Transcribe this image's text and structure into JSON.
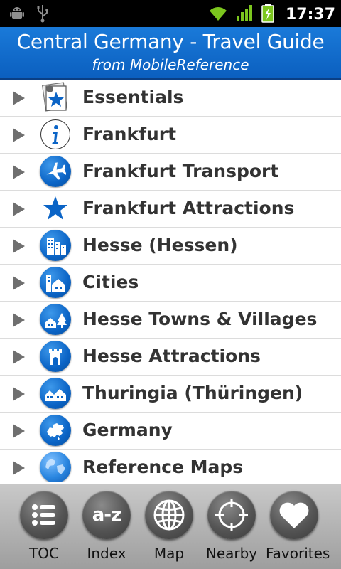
{
  "status_bar": {
    "time": "17:37"
  },
  "header": {
    "title": "Central Germany - Travel Guide",
    "subtitle": "from MobileReference"
  },
  "list": {
    "items": [
      {
        "label": "Essentials",
        "icon": "essentials-star-icon"
      },
      {
        "label": "Frankfurt",
        "icon": "info-icon"
      },
      {
        "label": "Frankfurt Transport",
        "icon": "airplane-icon"
      },
      {
        "label": "Frankfurt Attractions",
        "icon": "star-icon"
      },
      {
        "label": "Hesse (Hessen)",
        "icon": "buildings-icon"
      },
      {
        "label": "Cities",
        "icon": "city-icon"
      },
      {
        "label": "Hesse Towns & Villages",
        "icon": "village-icon"
      },
      {
        "label": "Hesse Attractions",
        "icon": "castle-icon"
      },
      {
        "label": "Thuringia (Thüringen)",
        "icon": "houses-icon"
      },
      {
        "label": "Germany",
        "icon": "europe-map-icon"
      },
      {
        "label": "Reference Maps",
        "icon": "globe-icon"
      }
    ]
  },
  "tabbar": {
    "tabs": [
      {
        "label": "TOC",
        "icon": "list-icon"
      },
      {
        "label": "Index",
        "icon": "a-z-icon",
        "glyph": "a-z"
      },
      {
        "label": "Map",
        "icon": "globe-grid-icon"
      },
      {
        "label": "Nearby",
        "icon": "crosshair-icon"
      },
      {
        "label": "Favorites",
        "icon": "heart-icon"
      }
    ]
  },
  "colors": {
    "header_blue": "#0b5fbf",
    "icon_blue": "#0b64c6",
    "tabbar_gray": "#b0b0b0"
  }
}
